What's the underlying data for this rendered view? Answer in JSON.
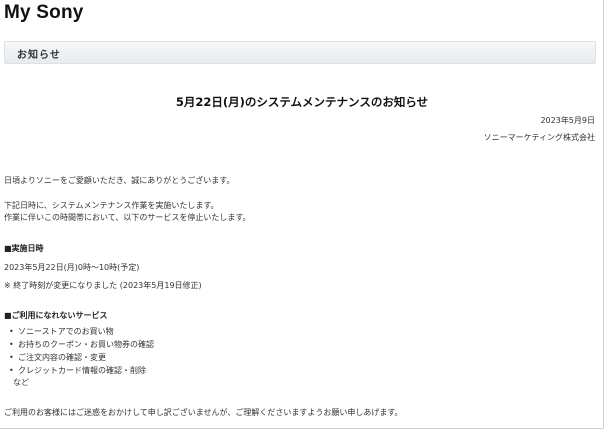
{
  "header": {
    "brand": "My Sony"
  },
  "section": {
    "title": "お知らせ"
  },
  "notice": {
    "title": "5月22日(月)のシステムメンテナンスのお知らせ",
    "date": "2023年5月9日",
    "company": "ソニーマーケティング株式会社",
    "greeting": "日頃よりソニーをご愛顧いただき、誠にありがとうございます。",
    "intro_1": "下記日時に、システムメンテナンス作業を実施いたします。",
    "intro_2": "作業に伴いこの時間帯において、以下のサービスを停止いたします。",
    "schedule_heading": "■実施日時",
    "schedule_value": "2023年5月22日(月)0時～10時(予定)",
    "schedule_note": "※ 終了時刻が変更になりました (2023年5月19日修正)",
    "services_heading": "■ご利用になれないサービス",
    "services": [
      {
        "bullet": "•",
        "label": "ソニーストアでのお買い物"
      },
      {
        "bullet": "•",
        "label": "お持ちのクーポン・お買い物券の確認"
      },
      {
        "bullet": "•",
        "label": "ご注文内容の確認・変更"
      },
      {
        "bullet": "•",
        "label": "クレジットカード情報の確認・削除"
      }
    ],
    "services_etc": "など",
    "closing": "ご利用のお客様にはご迷惑をおかけして申し訳ございませんが、ご理解くださいますようお願い申しあげます。"
  }
}
